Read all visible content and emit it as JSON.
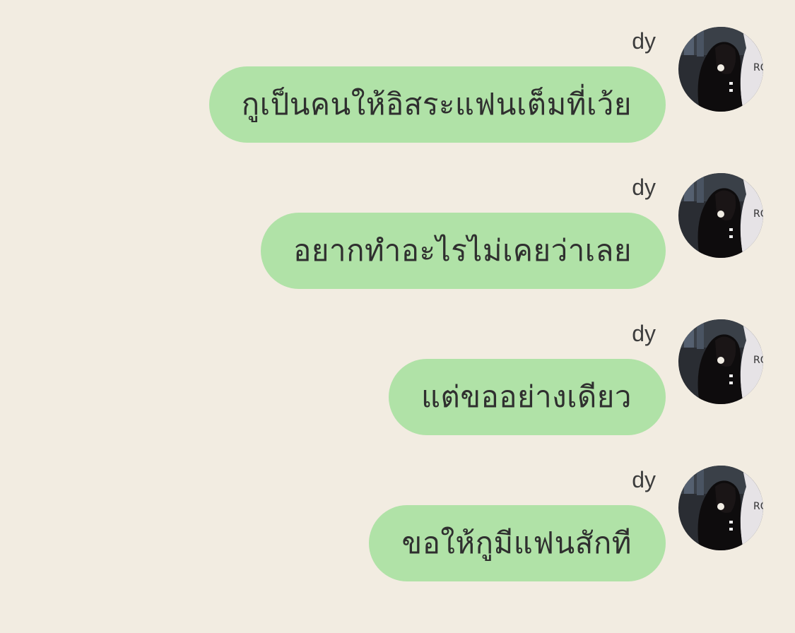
{
  "conversation": {
    "messages": [
      {
        "sender": "dy",
        "text": "กูเป็นคนให้อิสระแฟนเต็มที่เว้ย"
      },
      {
        "sender": "dy",
        "text": "อยากทำอะไรไม่เคยว่าเลย"
      },
      {
        "sender": "dy",
        "text": "แต่ขออย่างเดียว"
      },
      {
        "sender": "dy",
        "text": "ขอให้กูมีแฟนสักที"
      }
    ]
  },
  "colors": {
    "background": "#f2ece1",
    "bubble": "#b0e2a7",
    "text": "#2f2f2f",
    "sender": "#3d3d3d"
  },
  "icons": {
    "avatar": "profile-photo-avatar"
  }
}
